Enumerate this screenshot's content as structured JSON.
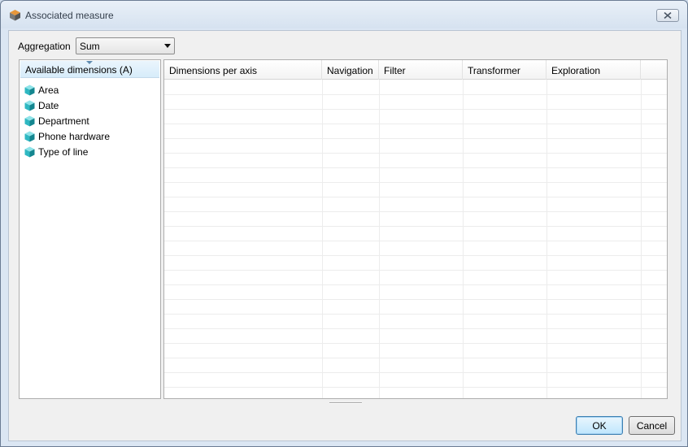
{
  "window": {
    "title": "Associated measure",
    "icon": "app-cube-icon"
  },
  "aggregation": {
    "label": "Aggregation",
    "selected": "Sum"
  },
  "available_dimensions": {
    "header": "Available dimensions (A)",
    "items": [
      {
        "label": "Area",
        "icon": "dimension-cube-icon"
      },
      {
        "label": "Date",
        "icon": "dimension-cube-icon"
      },
      {
        "label": "Department",
        "icon": "dimension-cube-icon"
      },
      {
        "label": "Phone hardware",
        "icon": "dimension-cube-icon"
      },
      {
        "label": "Type of line",
        "icon": "dimension-cube-icon"
      }
    ]
  },
  "table": {
    "columns": [
      "Dimensions per axis",
      "Navigation",
      "Filter",
      "Transformer",
      "Exploration"
    ],
    "rows": []
  },
  "buttons": {
    "ok": "OK",
    "cancel": "Cancel"
  },
  "colors": {
    "accent": "#3c7fb1",
    "cube": "#2fb8c2",
    "header_selected": "#d7ecfa"
  }
}
